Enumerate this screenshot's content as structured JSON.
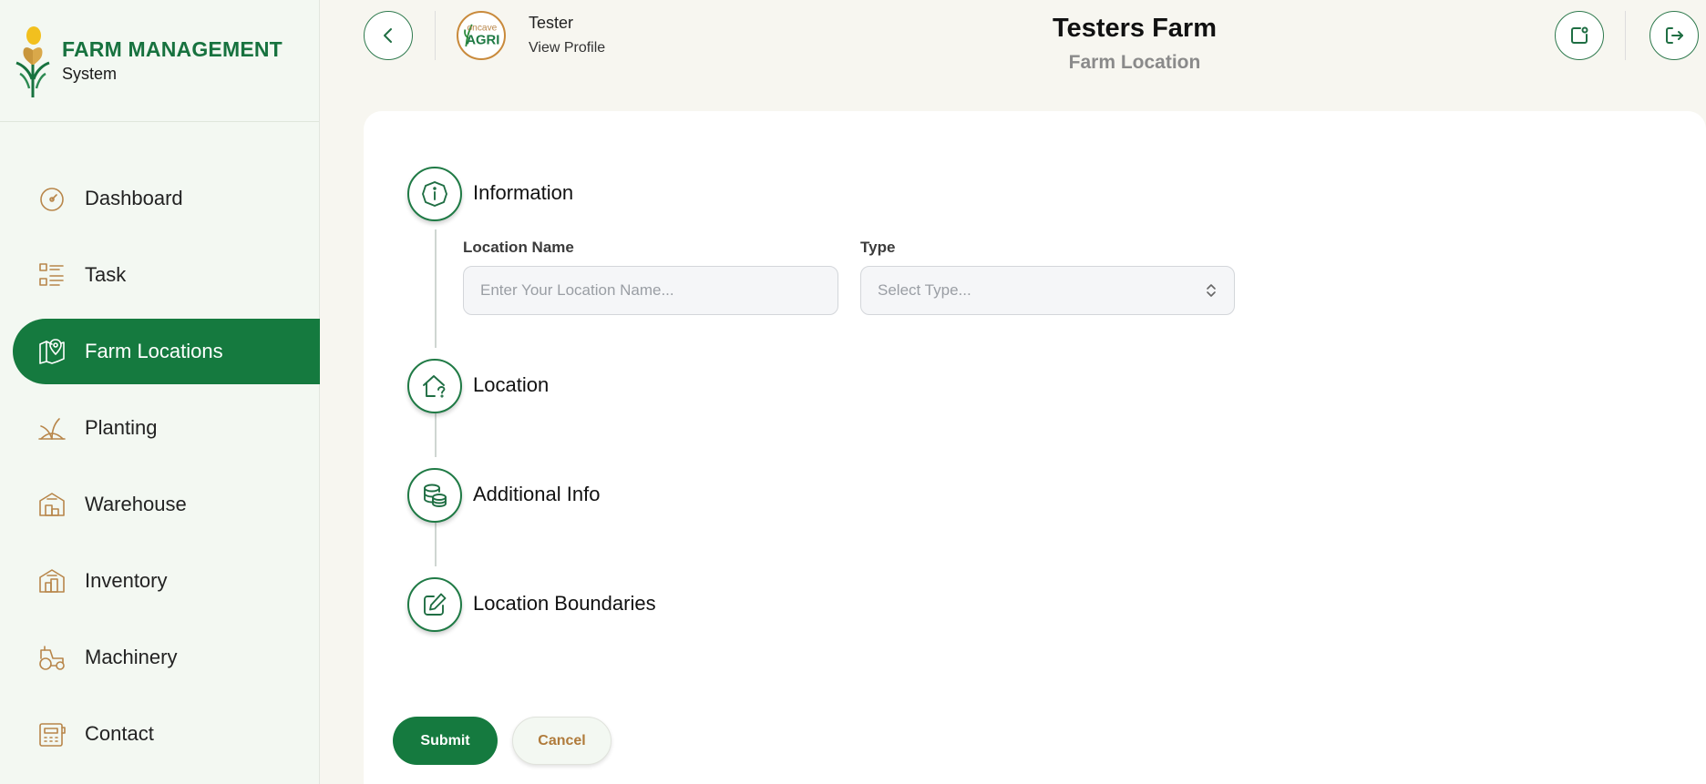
{
  "brand": {
    "title": "FARM MANAGEMENT",
    "subtitle": "System",
    "logo_icon": "wheat-logo-icon"
  },
  "colors": {
    "primary_green": "#157a3f",
    "accent_gold": "#b8864a",
    "sidebar_bg": "#f3f8f2",
    "page_bg": "#f7f6f0"
  },
  "sidebar": {
    "active_item": "Farm Locations",
    "items": [
      {
        "label": "Dashboard",
        "icon": "gauge-icon"
      },
      {
        "label": "Task",
        "icon": "task-list-icon"
      },
      {
        "label": "Farm Locations",
        "icon": "map-pin-icon"
      },
      {
        "label": "Planting",
        "icon": "sprout-icon"
      },
      {
        "label": "Warehouse",
        "icon": "warehouse-icon"
      },
      {
        "label": "Inventory",
        "icon": "inventory-icon"
      },
      {
        "label": "Machinery",
        "icon": "tractor-icon"
      },
      {
        "label": "Contact",
        "icon": "contact-icon"
      }
    ]
  },
  "header": {
    "user_name": "Tester",
    "view_profile": "View Profile",
    "avatar_text": "Concave AGRI",
    "title": "Testers Farm",
    "subtitle": "Farm Location"
  },
  "steps": [
    {
      "label": "Information",
      "icon": "info-icon"
    },
    {
      "label": "Location",
      "icon": "home-question-icon"
    },
    {
      "label": "Additional Info",
      "icon": "coins-icon"
    },
    {
      "label": "Location Boundaries",
      "icon": "edit-icon"
    }
  ],
  "form": {
    "location_name_label": "Location Name",
    "location_name_placeholder": "Enter Your Location Name...",
    "location_name_value": "",
    "type_label": "Type",
    "type_placeholder": "Select Type..."
  },
  "actions": {
    "submit": "Submit",
    "cancel": "Cancel"
  }
}
